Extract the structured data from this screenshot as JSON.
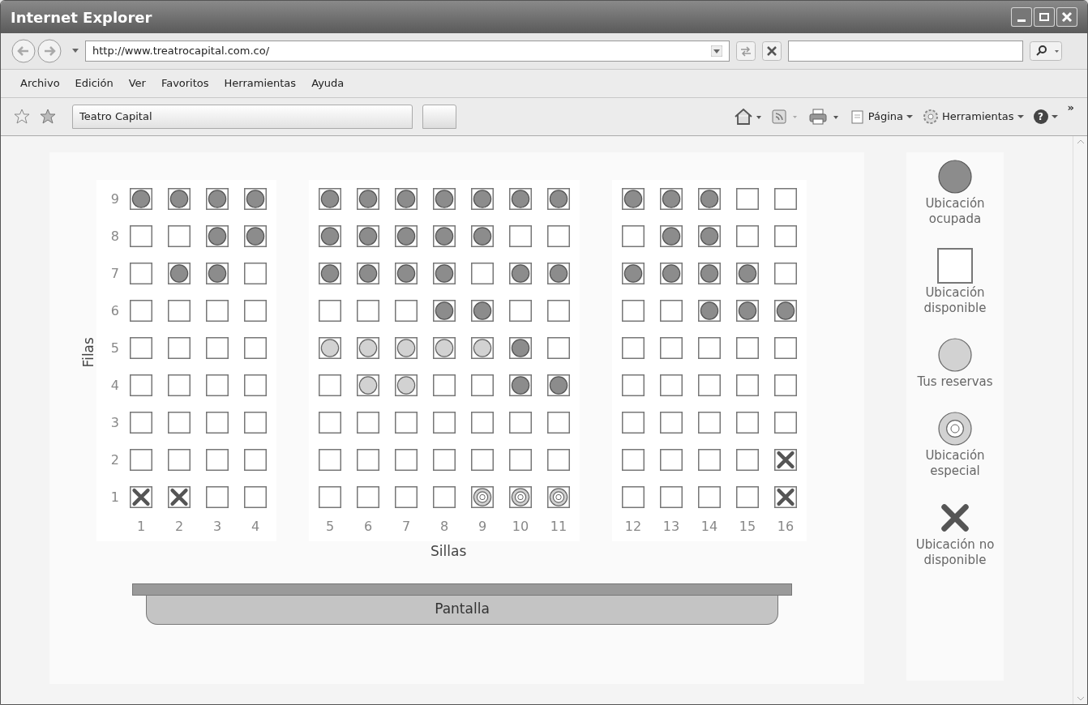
{
  "window": {
    "title": "Internet Explorer"
  },
  "address_bar": {
    "url": "http://www.treatrocapital.com.co/"
  },
  "menu": [
    "Archivo",
    "Edición",
    "Ver",
    "Favoritos",
    "Herramientas",
    "Ayuda"
  ],
  "tab": {
    "label": "Teatro Capital"
  },
  "command_bar": {
    "buttons": [
      "Página",
      "Herramientas"
    ],
    "help": "?",
    "overflow": "»"
  },
  "seat_map": {
    "row_axis_label": "Filas",
    "column_axis_label": "Sillas",
    "screen_label": "Pantalla",
    "sections": [
      {
        "columns": [
          "1",
          "2",
          "3",
          "4"
        ]
      },
      {
        "columns": [
          "5",
          "6",
          "7",
          "8",
          "9",
          "10",
          "11"
        ]
      },
      {
        "columns": [
          "12",
          "13",
          "14",
          "15",
          "16"
        ]
      }
    ],
    "rows": [
      {
        "label": "9",
        "seats": [
          {
            "kind": "occupied"
          },
          {
            "kind": "occupied"
          },
          {
            "kind": "occupied"
          },
          {
            "kind": "occupied"
          },
          {
            "kind": "occupied"
          },
          {
            "kind": "occupied"
          },
          {
            "kind": "occupied"
          },
          {
            "kind": "occupied"
          },
          {
            "kind": "occupied"
          },
          {
            "kind": "occupied"
          },
          {
            "kind": "occupied"
          },
          {
            "kind": "occupied"
          },
          {
            "kind": "occupied"
          },
          {
            "kind": "occupied"
          },
          {
            "kind": "available"
          },
          {
            "kind": "available"
          }
        ]
      },
      {
        "label": "8",
        "seats": [
          {
            "kind": "available"
          },
          {
            "kind": "available"
          },
          {
            "kind": "occupied"
          },
          {
            "kind": "occupied"
          },
          {
            "kind": "occupied"
          },
          {
            "kind": "occupied"
          },
          {
            "kind": "occupied"
          },
          {
            "kind": "occupied"
          },
          {
            "kind": "occupied"
          },
          {
            "kind": "available"
          },
          {
            "kind": "available"
          },
          {
            "kind": "available"
          },
          {
            "kind": "occupied"
          },
          {
            "kind": "occupied"
          },
          {
            "kind": "available"
          },
          {
            "kind": "available"
          }
        ]
      },
      {
        "label": "7",
        "seats": [
          {
            "kind": "available"
          },
          {
            "kind": "occupied"
          },
          {
            "kind": "occupied"
          },
          {
            "kind": "available"
          },
          {
            "kind": "occupied"
          },
          {
            "kind": "occupied"
          },
          {
            "kind": "occupied"
          },
          {
            "kind": "occupied"
          },
          {
            "kind": "available"
          },
          {
            "kind": "occupied"
          },
          {
            "kind": "occupied"
          },
          {
            "kind": "occupied"
          },
          {
            "kind": "occupied"
          },
          {
            "kind": "occupied"
          },
          {
            "kind": "occupied"
          },
          {
            "kind": "available"
          }
        ]
      },
      {
        "label": "6",
        "seats": [
          {
            "kind": "available"
          },
          {
            "kind": "available"
          },
          {
            "kind": "available"
          },
          {
            "kind": "available"
          },
          {
            "kind": "available"
          },
          {
            "kind": "available"
          },
          {
            "kind": "available"
          },
          {
            "kind": "occupied"
          },
          {
            "kind": "occupied"
          },
          {
            "kind": "available"
          },
          {
            "kind": "available"
          },
          {
            "kind": "available"
          },
          {
            "kind": "available"
          },
          {
            "kind": "occupied"
          },
          {
            "kind": "occupied"
          },
          {
            "kind": "occupied"
          }
        ]
      },
      {
        "label": "5",
        "seats": [
          {
            "kind": "available"
          },
          {
            "kind": "available"
          },
          {
            "kind": "available"
          },
          {
            "kind": "available"
          },
          {
            "kind": "reserved"
          },
          {
            "kind": "reserved"
          },
          {
            "kind": "reserved"
          },
          {
            "kind": "reserved"
          },
          {
            "kind": "reserved"
          },
          {
            "kind": "occupied"
          },
          {
            "kind": "available"
          },
          {
            "kind": "available"
          },
          {
            "kind": "available"
          },
          {
            "kind": "available"
          },
          {
            "kind": "available"
          },
          {
            "kind": "available"
          }
        ]
      },
      {
        "label": "4",
        "seats": [
          {
            "kind": "available"
          },
          {
            "kind": "available"
          },
          {
            "kind": "available"
          },
          {
            "kind": "available"
          },
          {
            "kind": "available"
          },
          {
            "kind": "reserved"
          },
          {
            "kind": "reserved"
          },
          {
            "kind": "available"
          },
          {
            "kind": "available"
          },
          {
            "kind": "occupied"
          },
          {
            "kind": "occupied"
          },
          {
            "kind": "available"
          },
          {
            "kind": "available"
          },
          {
            "kind": "available"
          },
          {
            "kind": "available"
          },
          {
            "kind": "available"
          }
        ]
      },
      {
        "label": "3",
        "seats": [
          {
            "kind": "available"
          },
          {
            "kind": "available"
          },
          {
            "kind": "available"
          },
          {
            "kind": "available"
          },
          {
            "kind": "available"
          },
          {
            "kind": "available"
          },
          {
            "kind": "available"
          },
          {
            "kind": "available"
          },
          {
            "kind": "available"
          },
          {
            "kind": "available"
          },
          {
            "kind": "available"
          },
          {
            "kind": "available"
          },
          {
            "kind": "available"
          },
          {
            "kind": "available"
          },
          {
            "kind": "available"
          },
          {
            "kind": "available"
          }
        ]
      },
      {
        "label": "2",
        "seats": [
          {
            "kind": "available"
          },
          {
            "kind": "available"
          },
          {
            "kind": "available"
          },
          {
            "kind": "available"
          },
          {
            "kind": "available"
          },
          {
            "kind": "available"
          },
          {
            "kind": "available"
          },
          {
            "kind": "available"
          },
          {
            "kind": "available"
          },
          {
            "kind": "available"
          },
          {
            "kind": "available"
          },
          {
            "kind": "available"
          },
          {
            "kind": "available"
          },
          {
            "kind": "available"
          },
          {
            "kind": "available"
          },
          {
            "kind": "unavailable"
          }
        ]
      },
      {
        "label": "1",
        "seats": [
          {
            "kind": "unavailable"
          },
          {
            "kind": "unavailable"
          },
          {
            "kind": "available"
          },
          {
            "kind": "available"
          },
          {
            "kind": "available"
          },
          {
            "kind": "available"
          },
          {
            "kind": "available"
          },
          {
            "kind": "available"
          },
          {
            "kind": "special"
          },
          {
            "kind": "special"
          },
          {
            "kind": "special"
          },
          {
            "kind": "available"
          },
          {
            "kind": "available"
          },
          {
            "kind": "available"
          },
          {
            "kind": "available"
          },
          {
            "kind": "unavailable"
          }
        ]
      }
    ]
  },
  "legend": [
    {
      "kind": "occupied",
      "label": "Ubicación ocupada"
    },
    {
      "kind": "available",
      "label": "Ubicación disponible"
    },
    {
      "kind": "reserved",
      "label": "Tus reservas"
    },
    {
      "kind": "special",
      "label": "Ubicación especial"
    },
    {
      "kind": "unavailable",
      "label": "Ubicación no disponible"
    }
  ]
}
